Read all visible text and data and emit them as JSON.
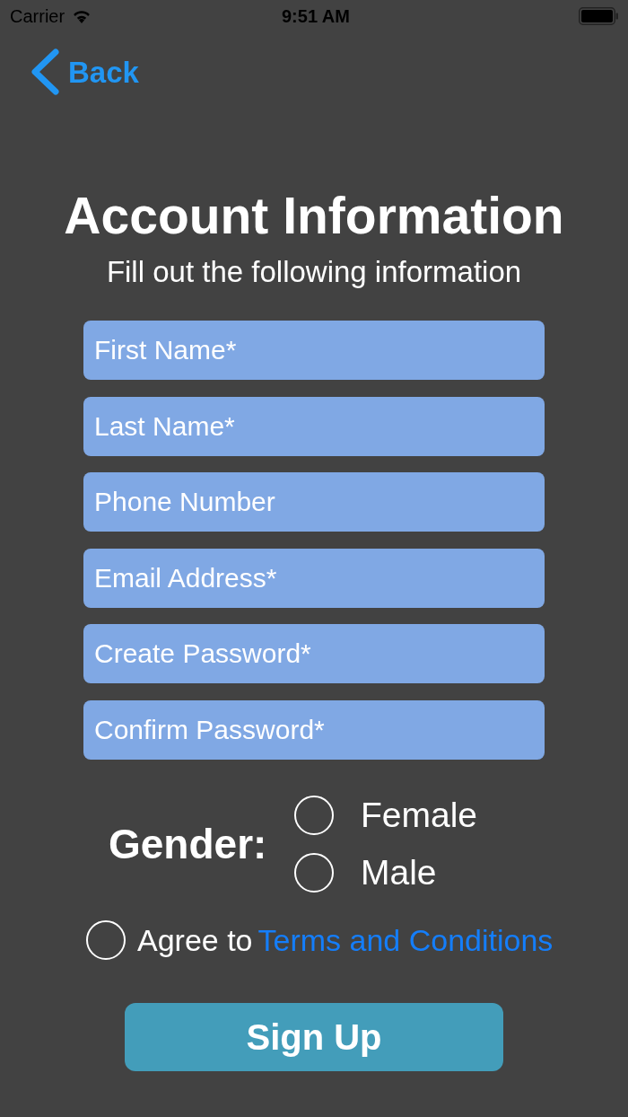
{
  "status_bar": {
    "carrier": "Carrier",
    "time": "9:51 AM"
  },
  "nav": {
    "back": "Back"
  },
  "title": "Account Information",
  "subtitle": "Fill out the following information",
  "fields": [
    {
      "placeholder": "First Name*"
    },
    {
      "placeholder": "Last Name*"
    },
    {
      "placeholder": "Phone Number"
    },
    {
      "placeholder": "Email Address*"
    },
    {
      "placeholder": "Create Password*"
    },
    {
      "placeholder": "Confirm Password*"
    }
  ],
  "gender": {
    "label": "Gender:",
    "options": [
      {
        "label": "Female",
        "selected": false
      },
      {
        "label": "Male",
        "selected": false
      }
    ]
  },
  "terms": {
    "text": "Agree to",
    "link": "Terms and Conditions",
    "checked": false
  },
  "submit": "Sign Up"
}
